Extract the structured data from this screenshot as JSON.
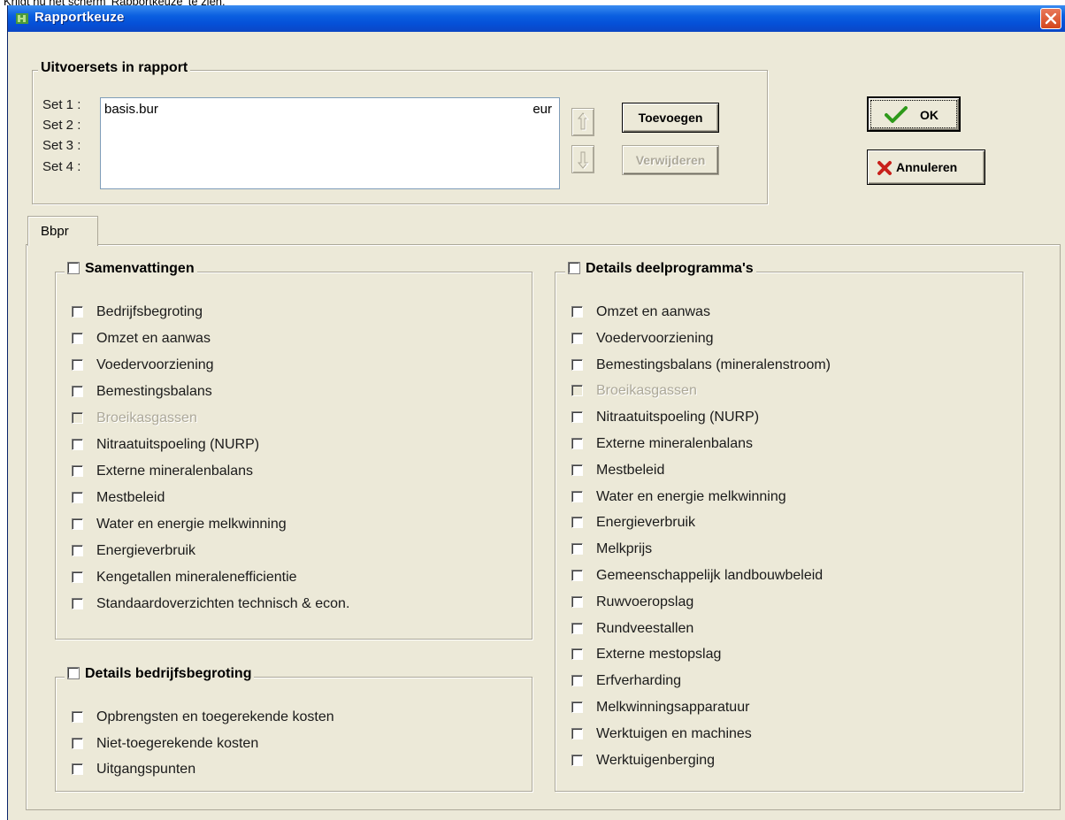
{
  "page_caption": "Krijgt nu het scherm 'Rapportkeuze' te zien.",
  "window": {
    "title": "Rapportkeuze",
    "close_label": "×"
  },
  "output_sets": {
    "legend": "Uitvoersets in rapport",
    "set_labels": [
      "Set 1 :",
      "Set 2 :",
      "Set 3 :",
      "Set 4 :"
    ],
    "entries": [
      {
        "name": "basis.bur",
        "currency": "eur"
      }
    ],
    "add_label": "Toevoegen",
    "remove_label": "Verwijderen"
  },
  "buttons": {
    "ok_label": "OK",
    "cancel_label": "Annuleren"
  },
  "tabs": [
    {
      "label": "Bbpr",
      "selected": true
    }
  ],
  "groups": {
    "samenvattingen": {
      "legend": "Samenvattingen",
      "items": [
        {
          "label": "Bedrijfsbegroting",
          "checked": false,
          "enabled": true
        },
        {
          "label": "Omzet en aanwas",
          "checked": false,
          "enabled": true
        },
        {
          "label": "Voedervoorziening",
          "checked": false,
          "enabled": true
        },
        {
          "label": "Bemestingsbalans",
          "checked": false,
          "enabled": true
        },
        {
          "label": "Broeikasgassen",
          "checked": false,
          "enabled": false
        },
        {
          "label": "Nitraatuitspoeling (NURP)",
          "checked": false,
          "enabled": true
        },
        {
          "label": "Externe mineralenbalans",
          "checked": false,
          "enabled": true
        },
        {
          "label": "Mestbeleid",
          "checked": false,
          "enabled": true
        },
        {
          "label": "Water en energie melkwinning",
          "checked": false,
          "enabled": true
        },
        {
          "label": "Energieverbruik",
          "checked": false,
          "enabled": true
        },
        {
          "label": "Kengetallen mineralenefficientie",
          "checked": false,
          "enabled": true
        },
        {
          "label": "Standaardoverzichten technisch & econ.",
          "checked": false,
          "enabled": true
        }
      ]
    },
    "bedrijfsbegroting": {
      "legend": "Details bedrijfsbegroting",
      "items": [
        {
          "label": "Opbrengsten en toegerekende kosten",
          "checked": false,
          "enabled": true
        },
        {
          "label": "Niet-toegerekende kosten",
          "checked": false,
          "enabled": true
        },
        {
          "label": "Uitgangspunten",
          "checked": false,
          "enabled": true
        }
      ]
    },
    "deelprogrammas": {
      "legend": "Details deelprogramma's",
      "items": [
        {
          "label": "Omzet en aanwas",
          "checked": false,
          "enabled": true
        },
        {
          "label": "Voedervoorziening",
          "checked": false,
          "enabled": true
        },
        {
          "label": "Bemestingsbalans (mineralenstroom)",
          "checked": false,
          "enabled": true
        },
        {
          "label": "Broeikasgassen",
          "checked": false,
          "enabled": false
        },
        {
          "label": "Nitraatuitspoeling (NURP)",
          "checked": false,
          "enabled": true
        },
        {
          "label": "Externe mineralenbalans",
          "checked": false,
          "enabled": true
        },
        {
          "label": "Mestbeleid",
          "checked": false,
          "enabled": true
        },
        {
          "label": "Water en energie melkwinning",
          "checked": false,
          "enabled": true
        },
        {
          "label": "Energieverbruik",
          "checked": false,
          "enabled": true
        },
        {
          "label": "Melkprijs",
          "checked": false,
          "enabled": true
        },
        {
          "label": "Gemeenschappelijk landbouwbeleid",
          "checked": false,
          "enabled": true
        },
        {
          "label": "Ruwvoeropslag",
          "checked": false,
          "enabled": true
        },
        {
          "label": "Rundveestallen",
          "checked": false,
          "enabled": true
        },
        {
          "label": "Externe mestopslag",
          "checked": false,
          "enabled": true
        },
        {
          "label": "Erfverharding",
          "checked": false,
          "enabled": true
        },
        {
          "label": "Melkwinningsapparatuur",
          "checked": false,
          "enabled": true
        },
        {
          "label": "Werktuigen en machines",
          "checked": false,
          "enabled": true
        },
        {
          "label": "Werktuigenberging",
          "checked": false,
          "enabled": true
        }
      ]
    }
  },
  "colors": {
    "titlebar": "#0550d8",
    "dialog_bg": "#ece9d8",
    "ok_check": "#2e9a1a",
    "cancel_x": "#c8201a",
    "disabled_text": "#aca899"
  }
}
